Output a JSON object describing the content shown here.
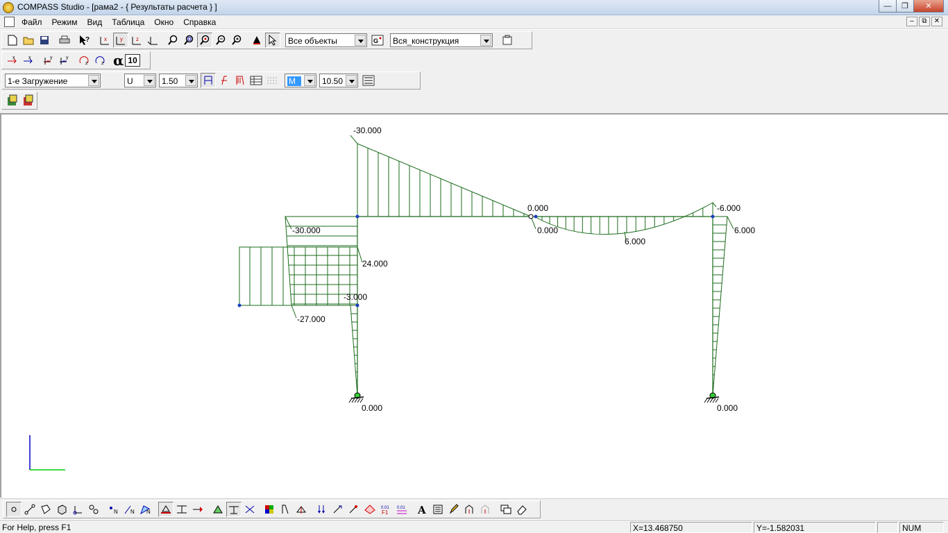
{
  "window": {
    "title": "COMPASS  Studio - [рама2 - { Результаты расчета } ]",
    "controls": [
      "—",
      "❐",
      "✕"
    ]
  },
  "menu": {
    "items": [
      "Файл",
      "Режим",
      "Вид",
      "Таблица",
      "Окно",
      "Справка"
    ],
    "mdi_controls": [
      "–",
      "⧉",
      "✕"
    ]
  },
  "toolbar": {
    "objects_combo": "Все объекты",
    "construction_combo": "Вся_конструкция",
    "alpha_symbol": "α",
    "alpha_value": "10",
    "load_case_combo": "1-е Загружение",
    "component_combo": "U",
    "scale_combo": "1.50",
    "force_combo": "M",
    "size_combo": "10.50"
  },
  "diagram": {
    "labels": [
      "-30.000",
      "0.000",
      "-6.000",
      "-30.000",
      "0.000",
      "6.000",
      "6.000",
      "24.000",
      "-3.000",
      "-27.000",
      "0.000",
      "0.000"
    ],
    "color": "#1a6b1a",
    "node_color": "#1a3fbf"
  },
  "status": {
    "help": "For Help, press F1",
    "x": "X=13.468750",
    "y": "Y=-1.582031",
    "num": "NUM"
  }
}
